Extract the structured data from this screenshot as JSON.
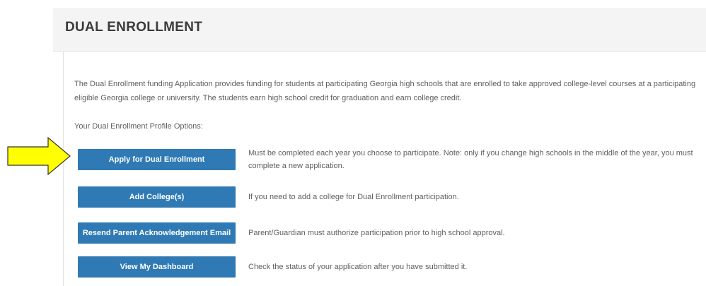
{
  "page": {
    "title": "DUAL ENROLLMENT"
  },
  "intro": {
    "text": "The Dual Enrollment funding Application provides funding for students at participating Georgia high schools that are enrolled to take approved college-level courses at a participating eligible Georgia college or university. The students earn high school credit for graduation and earn college credit."
  },
  "options": {
    "label": "Your Dual Enrollment Profile Options:",
    "items": [
      {
        "button": "Apply for Dual Enrollment",
        "description": "Must be completed each year you choose to participate. Note: only if you change high schools in the middle of the year, you must complete a new application."
      },
      {
        "button": "Add College(s)",
        "description": "If you need to add a college for Dual Enrollment participation."
      },
      {
        "button": "Resend Parent Acknowledgement Email",
        "description": "Parent/Guardian must authorize participation prior to high school approval."
      },
      {
        "button": "View My Dashboard",
        "description": "Check the status of your application after you have submitted it."
      }
    ]
  },
  "colors": {
    "button": "#2f7ab4",
    "arrow_fill": "#ffff00",
    "arrow_stroke": "#333333",
    "header_band": "#f4f4f4"
  },
  "annotation": {
    "icon": "yellow-arrow-pointer-icon"
  }
}
